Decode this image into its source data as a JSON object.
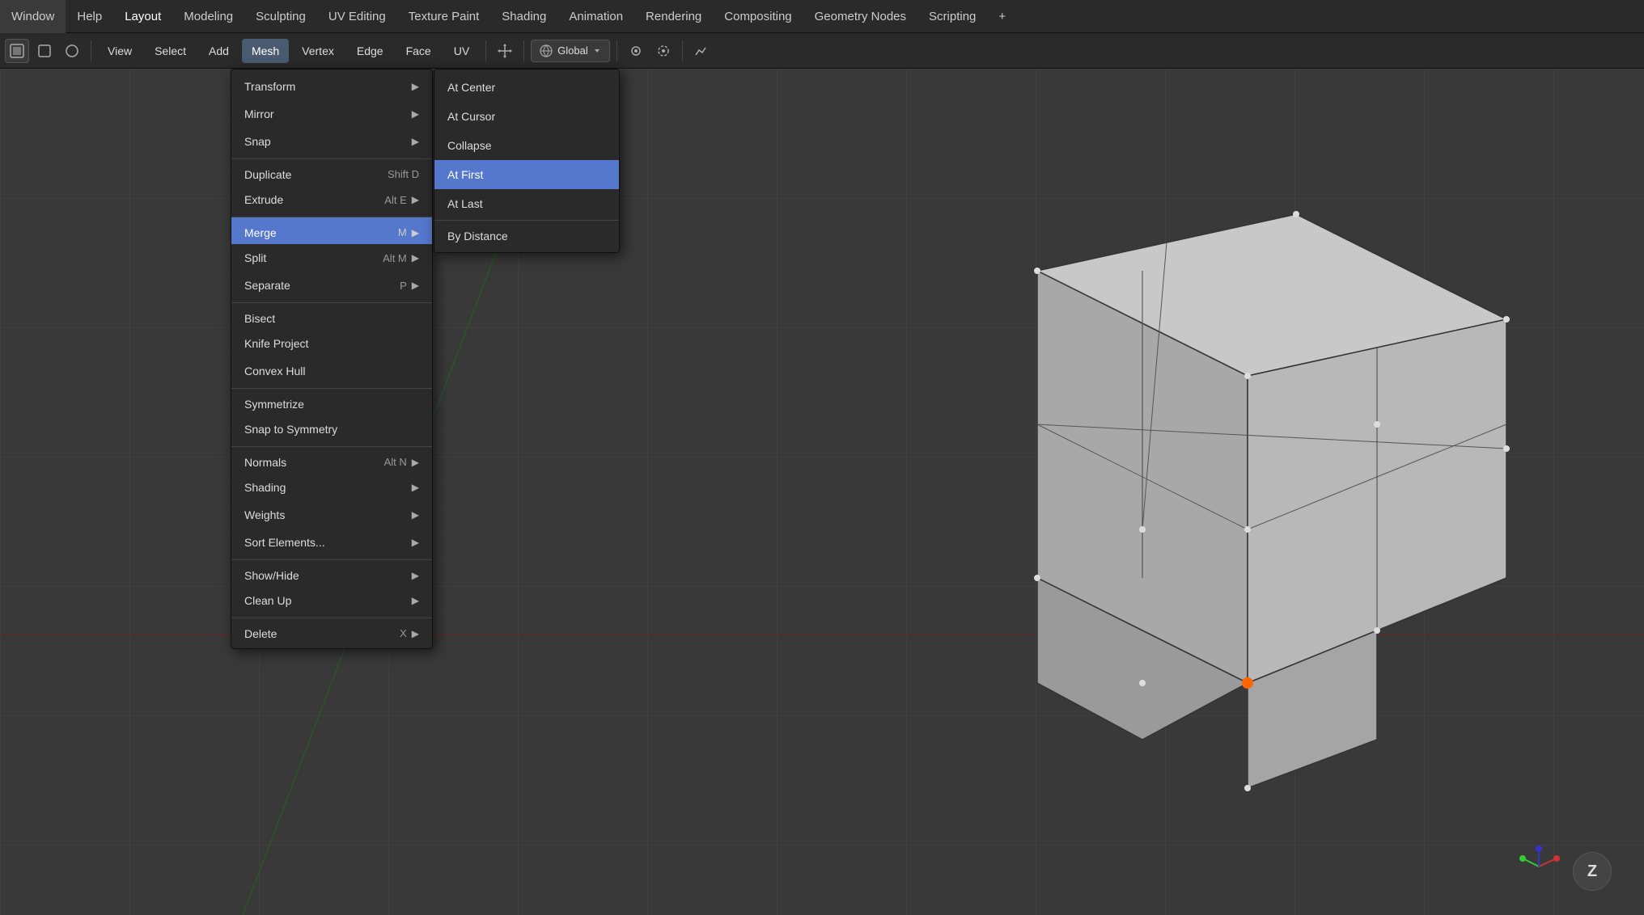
{
  "topbar": {
    "items": [
      {
        "id": "window",
        "label": "Window"
      },
      {
        "id": "help",
        "label": "Help"
      },
      {
        "id": "layout",
        "label": "Layout",
        "active": true
      },
      {
        "id": "modeling",
        "label": "Modeling"
      },
      {
        "id": "sculpting",
        "label": "Sculpting"
      },
      {
        "id": "uv-editing",
        "label": "UV Editing"
      },
      {
        "id": "texture-paint",
        "label": "Texture Paint"
      },
      {
        "id": "shading",
        "label": "Shading"
      },
      {
        "id": "animation",
        "label": "Animation"
      },
      {
        "id": "rendering",
        "label": "Rendering"
      },
      {
        "id": "compositing",
        "label": "Compositing"
      },
      {
        "id": "geometry-nodes",
        "label": "Geometry Nodes"
      },
      {
        "id": "scripting",
        "label": "Scripting"
      },
      {
        "id": "add",
        "label": "+"
      }
    ]
  },
  "toolbar2": {
    "view_label": "View",
    "select_label": "Select",
    "add_label": "Add",
    "mesh_label": "Mesh",
    "vertex_label": "Vertex",
    "edge_label": "Edge",
    "face_label": "Face",
    "uv_label": "UV",
    "global_label": "Global",
    "mesh_highlighted": true
  },
  "main_menu": {
    "items": [
      {
        "id": "transform",
        "label": "Transform",
        "shortcut": "",
        "has_arrow": true
      },
      {
        "id": "mirror",
        "label": "Mirror",
        "shortcut": "",
        "has_arrow": true
      },
      {
        "id": "snap",
        "label": "Snap",
        "shortcut": "",
        "has_arrow": true
      },
      {
        "id": "duplicate",
        "label": "Duplicate",
        "shortcut": "Shift D",
        "has_arrow": false,
        "sep_above": true
      },
      {
        "id": "extrude",
        "label": "Extrude",
        "shortcut": "Alt E",
        "has_arrow": true
      },
      {
        "id": "merge",
        "label": "Merge",
        "shortcut": "M",
        "has_arrow": true,
        "highlighted": true,
        "sep_above": true
      },
      {
        "id": "split",
        "label": "Split",
        "shortcut": "Alt M",
        "has_arrow": true
      },
      {
        "id": "separate",
        "label": "Separate",
        "shortcut": "P",
        "has_arrow": true
      },
      {
        "id": "bisect",
        "label": "Bisect",
        "shortcut": "",
        "has_arrow": false,
        "sep_above": true
      },
      {
        "id": "knife-project",
        "label": "Knife Project",
        "shortcut": "",
        "has_arrow": false
      },
      {
        "id": "convex-hull",
        "label": "Convex Hull",
        "shortcut": "",
        "has_arrow": false
      },
      {
        "id": "symmetrize",
        "label": "Symmetrize",
        "shortcut": "",
        "has_arrow": false,
        "sep_above": true
      },
      {
        "id": "snap-to-symmetry",
        "label": "Snap to Symmetry",
        "shortcut": "",
        "has_arrow": false
      },
      {
        "id": "normals",
        "label": "Normals",
        "shortcut": "Alt N",
        "has_arrow": true,
        "sep_above": true
      },
      {
        "id": "shading",
        "label": "Shading",
        "shortcut": "",
        "has_arrow": true
      },
      {
        "id": "weights",
        "label": "Weights",
        "shortcut": "",
        "has_arrow": true
      },
      {
        "id": "sort-elements",
        "label": "Sort Elements...",
        "shortcut": "",
        "has_arrow": true
      },
      {
        "id": "show-hide",
        "label": "Show/Hide",
        "shortcut": "",
        "has_arrow": true,
        "sep_above": true
      },
      {
        "id": "clean-up",
        "label": "Clean Up",
        "shortcut": "",
        "has_arrow": true
      },
      {
        "id": "delete",
        "label": "Delete",
        "shortcut": "X",
        "has_arrow": true,
        "sep_above": true
      }
    ]
  },
  "merge_submenu": {
    "items": [
      {
        "id": "at-center",
        "label": "At Center",
        "highlighted": false
      },
      {
        "id": "at-cursor",
        "label": "At Cursor",
        "highlighted": false
      },
      {
        "id": "collapse",
        "label": "Collapse",
        "highlighted": false
      },
      {
        "id": "at-first",
        "label": "At First",
        "highlighted": true
      },
      {
        "id": "at-last",
        "label": "At Last",
        "highlighted": false
      },
      {
        "id": "by-distance",
        "label": "By Distance",
        "highlighted": false,
        "sep_above": true
      }
    ]
  },
  "zoom_button": {
    "label": "Z"
  },
  "cursor_icon": "⊕",
  "colors": {
    "bg_dark": "#393939",
    "menu_bg": "#2a2a2a",
    "highlight": "#5577cc",
    "grid_line": "#3f3f3f",
    "topbar_bg": "#2a2a2a"
  }
}
